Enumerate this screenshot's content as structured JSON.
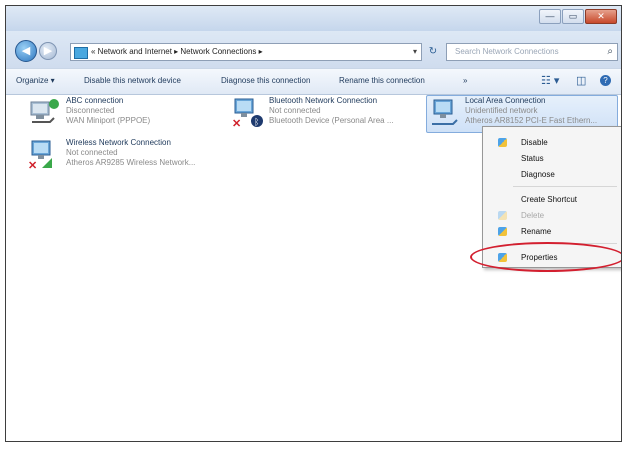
{
  "window": {
    "controls": {
      "minimize": "—",
      "maximize": "▭",
      "close": "✕"
    }
  },
  "address": {
    "back_icon": "◀",
    "forward_icon": "▶",
    "path": "« Network and Internet ▸ Network Connections ▸",
    "refresh_icon": "↻",
    "search_placeholder": "Search Network Connections",
    "search_icon": "⌕"
  },
  "toolbar": {
    "organize": "Organize ▾",
    "disable": "Disable this network device",
    "diagnose": "Diagnose this connection",
    "rename": "Rename this connection",
    "more": "»",
    "views_icon": "☷ ▾",
    "pane_icon": "◫",
    "help_icon": "?"
  },
  "connections": [
    {
      "name": "ABC connection",
      "status": "Disconnected",
      "device": "WAN Miniport (PPPOE)"
    },
    {
      "name": "Bluetooth Network Connection",
      "status": "Not connected",
      "device": "Bluetooth Device (Personal Area ..."
    },
    {
      "name": "Local Area Connection",
      "status": "Unidentified network",
      "device": "Atheros AR8152 PCI-E Fast Ethern..."
    },
    {
      "name": "Wireless Network Connection",
      "status": "Not connected",
      "device": "Atheros AR9285 Wireless Network..."
    }
  ],
  "context_menu": {
    "disable": "Disable",
    "status": "Status",
    "diagnose": "Diagnose",
    "create_shortcut": "Create Shortcut",
    "delete": "Delete",
    "rename": "Rename",
    "properties": "Properties"
  },
  "colors": {
    "highlight_ring": "#d31f2f",
    "selection": "#cfe1f7",
    "link_text": "#1e395b"
  }
}
